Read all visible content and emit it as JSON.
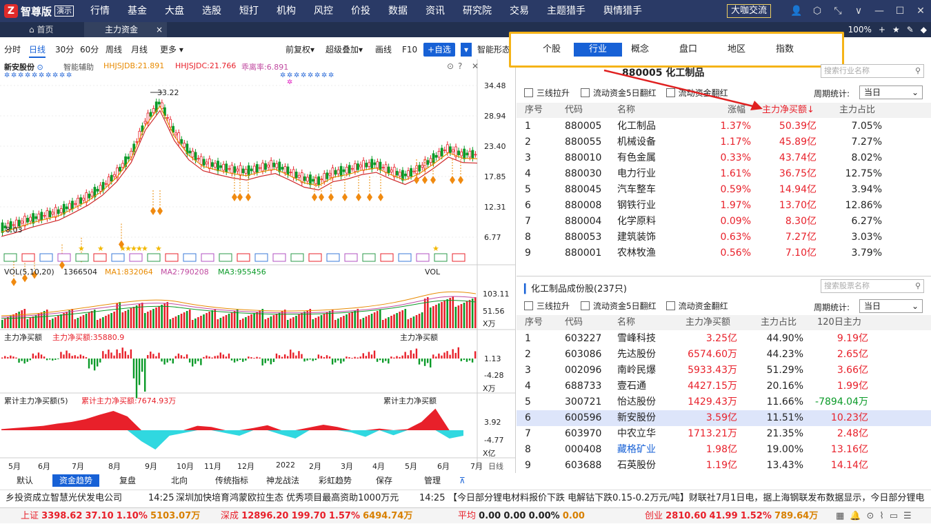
{
  "app": {
    "logo_char": "Z",
    "name": "智尊版",
    "badge": "演示"
  },
  "menu": [
    "行情",
    "基金",
    "大盘",
    "选股",
    "短打",
    "机构",
    "风控",
    "价投",
    "数据",
    "资讯",
    "研究院",
    "交易",
    "主题猎手",
    "舆情猎手"
  ],
  "cafe_label": "大咖交流",
  "tabs": {
    "home": "首页",
    "current": "主力资金",
    "close": "×"
  },
  "zoom": "100%",
  "toolbar": {
    "periods": [
      "分时",
      "日线",
      "30分",
      "60分",
      "周线",
      "月线",
      "更多 ▾"
    ],
    "fq": "前复权▾",
    "overlay": "超级叠加▾",
    "draw": "画线",
    "f10": "F10",
    "add": "+自选",
    "smart": "智能形态"
  },
  "stock": {
    "name": "新安股份",
    "assist": "智能辅助",
    "hhjsjdb": "HHJSJDB:21.891",
    "hhjsjdc": "HHJSJDC:21.766",
    "dev": "乖离率:6.891",
    "high": "33.22",
    "low": "8.03"
  },
  "price_axis": [
    "34.48",
    "28.94",
    "23.40",
    "17.85",
    "12.31",
    "6.77"
  ],
  "vol": {
    "title": "VOL(5,10,20)",
    "value": "1366504",
    "ma1": "MA1:832064",
    "ma2": "MA2:790208",
    "ma3": "MA3:955456",
    "axis": [
      "103.11",
      "51.56",
      "X万"
    ],
    "tag": "VOL"
  },
  "net": {
    "title": "主力净买额",
    "value": "主力净买额:35880.9",
    "tag": "主力净买额",
    "axis": [
      "1.13",
      "-4.28",
      "X万"
    ]
  },
  "cum": {
    "title": "累计主力净买额(5)",
    "value": "累计主力净买额:7674.93万",
    "tag": "累计主力净买额",
    "axis": [
      "3.92",
      "-4.77",
      "X亿"
    ]
  },
  "months": [
    "5月",
    "6月",
    "7月",
    "8月",
    "9月",
    "10月",
    "11月",
    "12月",
    "2022",
    "2月",
    "3月",
    "4月",
    "5月",
    "6月",
    "7月"
  ],
  "xaxis_tag": "日线",
  "bottom_tabs": [
    "默认",
    "资金趋势",
    "复盘",
    "北向",
    "传统指标",
    "神龙战法",
    "彩虹趋势",
    "保存",
    "管理"
  ],
  "cat_tabs": [
    "个股",
    "行业",
    "概念",
    "盘口",
    "地区",
    "指数"
  ],
  "industry": {
    "title": "880005  化工制品",
    "search": "搜索行业名称",
    "checks": [
      "三线拉升",
      "流动资金5日翻红",
      "流动资金翻红"
    ],
    "period_label": "周期统计:",
    "period_value": "当日",
    "headers": [
      "序号",
      "代码",
      "名称",
      "涨幅",
      "主力净买额↓",
      "主力占比"
    ],
    "rows": [
      [
        "1",
        "880005",
        "化工制品",
        "1.37%",
        "50.39亿",
        "7.05%"
      ],
      [
        "2",
        "880055",
        "机械设备",
        "1.17%",
        "45.89亿",
        "7.27%"
      ],
      [
        "3",
        "880010",
        "有色金属",
        "0.33%",
        "43.74亿",
        "8.02%"
      ],
      [
        "4",
        "880030",
        "电力行业",
        "1.61%",
        "36.75亿",
        "12.75%"
      ],
      [
        "5",
        "880045",
        "汽车整车",
        "0.59%",
        "14.94亿",
        "3.94%"
      ],
      [
        "6",
        "880008",
        "钢铁行业",
        "1.97%",
        "13.70亿",
        "12.86%"
      ],
      [
        "7",
        "880004",
        "化学原料",
        "0.09%",
        "8.30亿",
        "6.27%"
      ],
      [
        "8",
        "880053",
        "建筑装饰",
        "0.63%",
        "7.27亿",
        "3.03%"
      ],
      [
        "9",
        "880001",
        "农林牧渔",
        "0.56%",
        "7.10亿",
        "3.79%"
      ]
    ]
  },
  "constituents": {
    "title": "化工制品成份股(237只)",
    "search": "搜索股票名称",
    "checks": [
      "三线拉升",
      "流动资金5日翻红",
      "流动资金翻红"
    ],
    "period_label": "周期统计:",
    "period_value": "当日",
    "headers": [
      "序号",
      "代码",
      "名称",
      "主力净买额",
      "主力占比",
      "120日主力"
    ],
    "rows": [
      [
        "1",
        "603227",
        "雪峰科技",
        "3.25亿",
        "44.90%",
        "9.19亿"
      ],
      [
        "2",
        "603086",
        "先达股份",
        "6574.60万",
        "44.23%",
        "2.65亿"
      ],
      [
        "3",
        "002096",
        "南岭民爆",
        "5933.43万",
        "51.29%",
        "3.66亿"
      ],
      [
        "4",
        "688733",
        "壹石通",
        "4427.15万",
        "20.16%",
        "1.99亿"
      ],
      [
        "5",
        "300721",
        "怡达股份",
        "1429.43万",
        "11.66%",
        "-7894.04万"
      ],
      [
        "6",
        "600596",
        "新安股份",
        "3.59亿",
        "11.51%",
        "10.23亿"
      ],
      [
        "7",
        "603970",
        "中农立华",
        "1713.21万",
        "21.35%",
        "2.48亿"
      ],
      [
        "8",
        "000408",
        "藏格矿业",
        "1.98亿",
        "19.00%",
        "13.16亿"
      ],
      [
        "9",
        "603688",
        "石英股份",
        "1.19亿",
        "13.43%",
        "14.14亿"
      ]
    ]
  },
  "ticker": {
    "t1": "乡投资成立智慧光伏发电公司",
    "time1": "14:25",
    "t2": "深圳加快培育鸿蒙欧拉生态 优秀项目最高资助1000万元",
    "time2": "14:25",
    "t3": "【今日部分锂电材料报价下跌 电解钴下跌0.15-0.2万元/吨】财联社7月1日电，据上海钢联发布数据显示，今日部分锂电"
  },
  "status": {
    "sh_label": "上证",
    "sh": "3398.62",
    "sh_chg": "37.10",
    "sh_pct": "1.10%",
    "sh_amt": "5103.07万",
    "sz_label": "深成",
    "sz": "12896.20",
    "sz_chg": "199.70",
    "sz_pct": "1.57%",
    "sz_amt": "6494.74万",
    "avg_label": "平均",
    "avg": "0.00",
    "avg_chg": "0.00",
    "avg_pct": "0.00%",
    "avg_amt": "0.00",
    "cy_label": "创业",
    "cy": "2810.60",
    "cy_chg": "41.99",
    "cy_pct": "1.52%",
    "cy_amt": "789.64万"
  },
  "colors": {
    "up": "#e8202a",
    "down": "#0a9a28",
    "accent": "#1761d6",
    "highlight": "#f5b316"
  },
  "chart_data": {
    "type": "line",
    "x_months": [
      "5月",
      "6月",
      "7月",
      "8月",
      "9月",
      "10月",
      "11月",
      "12月",
      "2022",
      "2月",
      "3月",
      "4月",
      "5月",
      "6月",
      "7月"
    ],
    "price_close": [
      8.5,
      9.2,
      10.1,
      10.8,
      11.5,
      12.8,
      14.2,
      16.0,
      18.5,
      22.0,
      28.0,
      31.5,
      26.0,
      22.5,
      20.5,
      19.8,
      19.2,
      18.8,
      19.5,
      20.0,
      18.8,
      17.5,
      17.0,
      18.5,
      19.0,
      19.8,
      20.2,
      19.0,
      18.0,
      19.2,
      21.0,
      23.0,
      22.0,
      21.9
    ],
    "ylim": [
      6.77,
      34.48
    ],
    "net_buy": [
      0.3,
      -0.5,
      0.6,
      -0.2,
      0.8,
      0.4,
      -1.2,
      0.9,
      1.1,
      -4.0,
      0.7,
      -0.6,
      0.5,
      -0.8,
      0.3,
      0.6,
      -0.4,
      0.2,
      -0.7,
      0.5,
      0.9,
      -0.3,
      0.4,
      -0.6,
      0.2,
      0.8,
      -0.5,
      0.3,
      1.0,
      -0.9,
      0.6,
      1.13,
      -0.4,
      1.1
    ],
    "cum_net_buy": [
      0.2,
      0.4,
      0.6,
      0.8,
      1.2,
      1.5,
      2.0,
      2.8,
      3.5,
      2.5,
      -2.0,
      -3.5,
      -1.0,
      -0.5,
      0.8,
      0.6,
      -0.5,
      -1.0,
      0.4,
      0.9,
      -0.8,
      -1.5,
      0.5,
      1.0,
      0.6,
      -0.4,
      -1.2,
      0.3,
      -0.9,
      0.2,
      1.5,
      3.92,
      -1.5,
      -1.0
    ]
  }
}
